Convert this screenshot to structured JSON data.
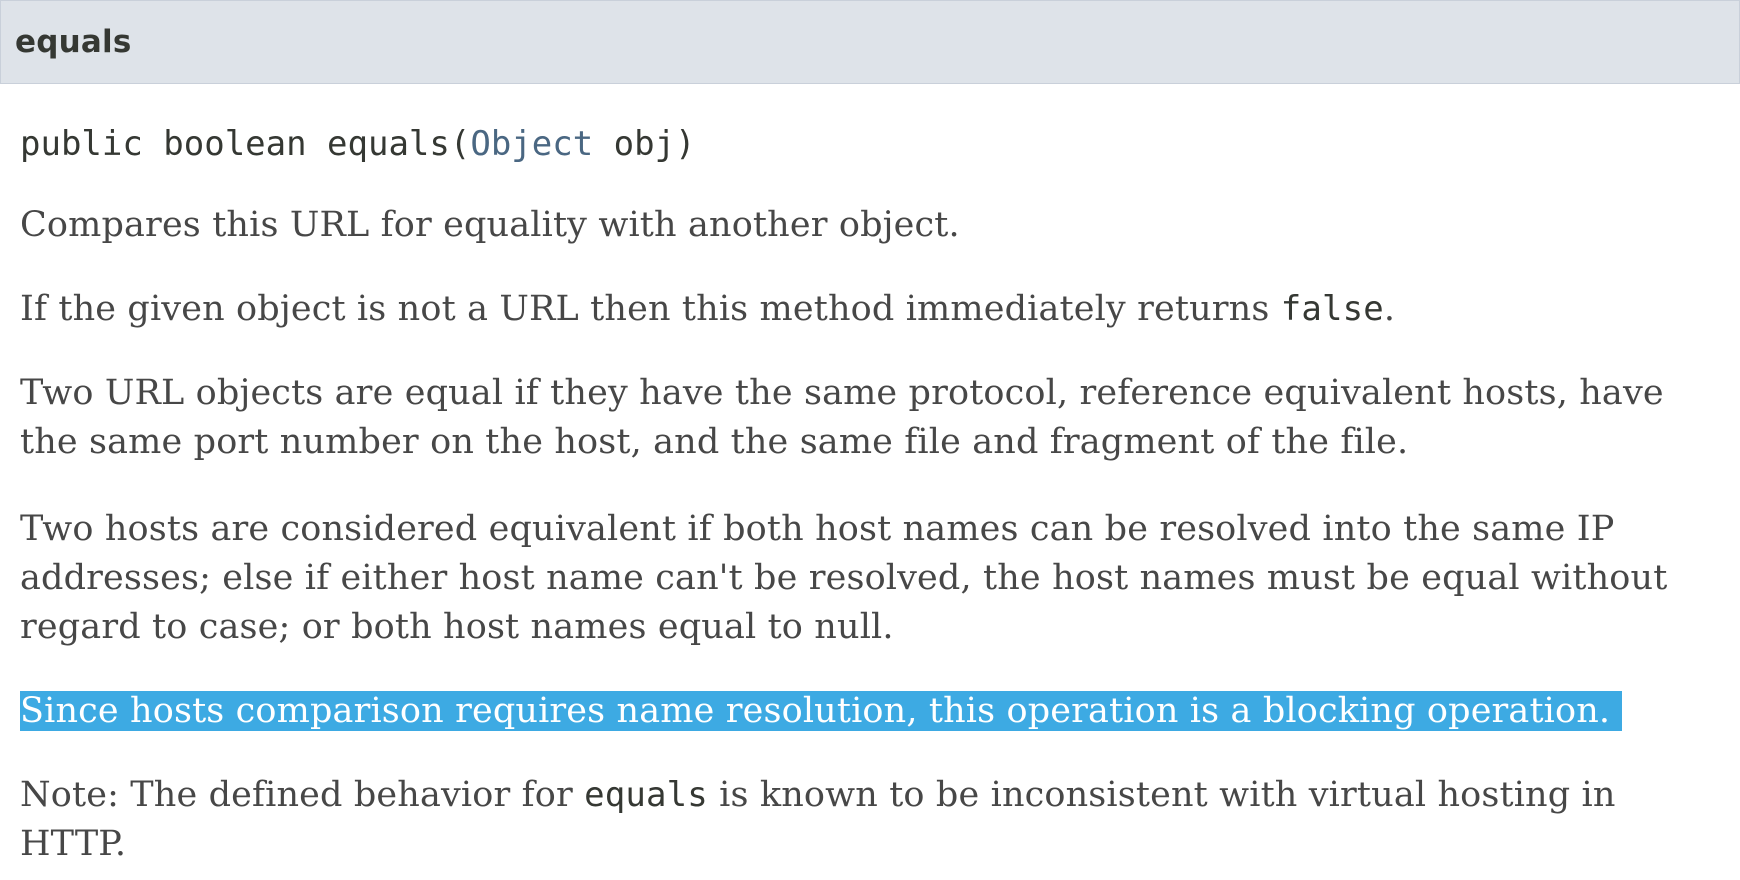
{
  "header": {
    "title": "equals"
  },
  "signature": {
    "prefix": "public boolean equals(",
    "param_type": "Object",
    "suffix": " obj)"
  },
  "description": {
    "p1": "Compares this URL for equality with another object.",
    "p2_before": "If the given object is not a URL then this method immediately returns ",
    "p2_code": "false",
    "p2_after": ".",
    "p3": "Two URL objects are equal if they have the same protocol, reference equivalent hosts, have the same port number on the host, and the same file and fragment of the file.",
    "p4": "Two hosts are considered equivalent if both host names can be resolved into the same IP addresses; else if either host name can't be resolved, the host names must be equal without regard to case; or both host names equal to null.",
    "p5_selected": "Since hosts comparison requires name resolution, this operation is a blocking operation.",
    "p6_before": "Note: The defined behavior for ",
    "p6_code": "equals",
    "p6_after": " is known to be inconsistent with virtual hosting in HTTP."
  },
  "colors": {
    "header_bg": "#dee3e9",
    "link": "#4a6782",
    "selection_bg": "#3daae3",
    "selection_text": "#ffffff",
    "body_text": "#474747"
  }
}
